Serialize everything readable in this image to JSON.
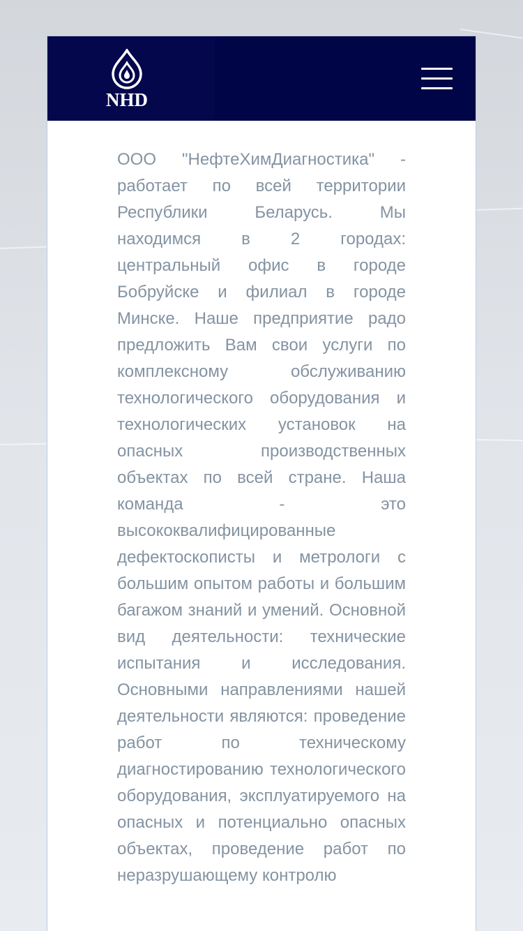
{
  "header": {
    "logo_text": "NHD",
    "menu_icon": "hamburger-menu-icon"
  },
  "content": {
    "text": "ООО \"НефтеХимДиагностика\" - работает по всей территории Республики Беларусь. Мы находимся в 2 городах: центральный офис в городе Бобруйске и филиал в городе Минске. Наше предприятие радо предложить Вам свои услуги по комплексному обслуживанию технологического оборудования и технологических установок на опасных производственных объектах по всей стране. Наша команда - это высококвалифицированные дефектоскописты и метрологи с большим опытом работы и большим багажом знаний и умений. Основной вид деятельности: технические испытания и исследования. Основными направлениями нашей деятельности являются: проведение работ по техническому диагностированию технологического оборудования, эксплуатируемого на опасных и потенциально опасных объектах, проведение работ по неразрушающему контролю"
  },
  "colors": {
    "header_bg": "#000547",
    "text": "#8493a2",
    "page_bg": "#dfe3e8"
  }
}
